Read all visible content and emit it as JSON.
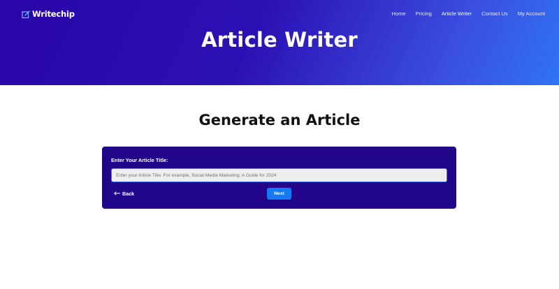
{
  "brand": {
    "name": "Writechip",
    "logo_icon": "edit-square-icon"
  },
  "nav": {
    "items": [
      {
        "label": "Home"
      },
      {
        "label": "Pricing"
      },
      {
        "label": "Article Writer",
        "active": true
      },
      {
        "label": "Contact Us"
      },
      {
        "label": "My Account"
      }
    ]
  },
  "hero": {
    "title": "Article Writer"
  },
  "main": {
    "title": "Generate an Article"
  },
  "form": {
    "label": "Enter Your Article Title:",
    "input_value": "",
    "placeholder": "Enter your Article Title. For example, Social Media Marketing: A Guide for 2024",
    "back_label": "Back",
    "back_icon": "arrow-left-icon",
    "next_label": "Next"
  },
  "colors": {
    "hero_gradient_start": "#2a06a8",
    "hero_gradient_end": "#2f74f2",
    "card_background": "#22068a",
    "next_button": "#1479f2",
    "input_border": "#4a7cf0"
  }
}
